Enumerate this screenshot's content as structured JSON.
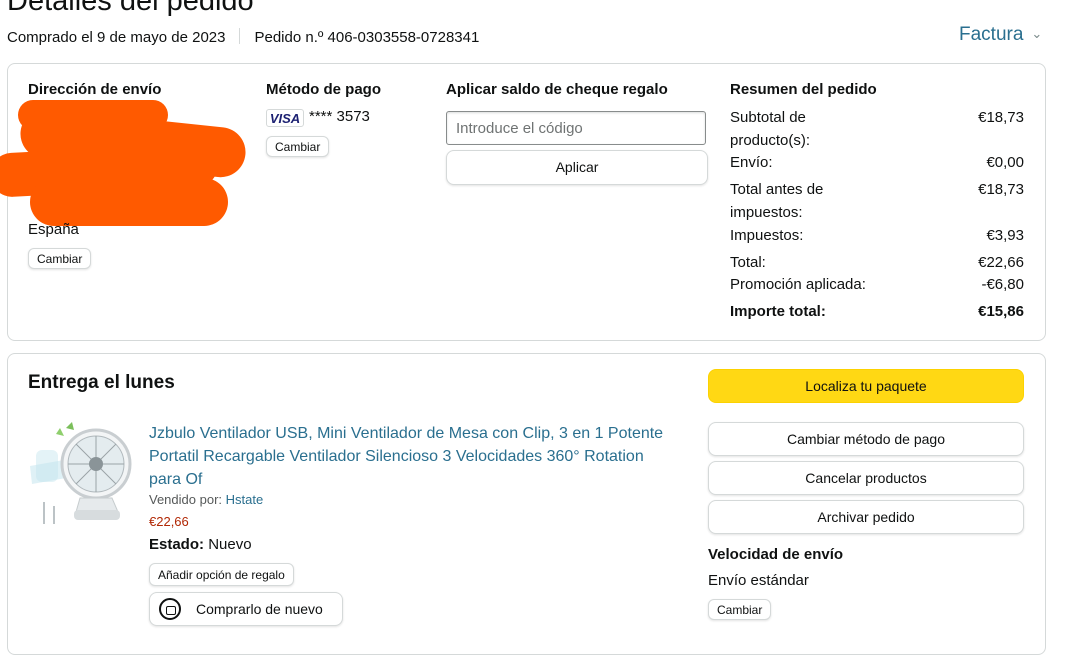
{
  "header": {
    "page_title": "Detalles del pedido",
    "purchased_on": "Comprado el 9 de mayo de 2023",
    "order_number": "Pedido n.º 406-0303558-0728341",
    "invoice_label": "Factura"
  },
  "shipping": {
    "title": "Dirección de envío",
    "country": "España",
    "change_label": "Cambiar"
  },
  "payment": {
    "title": "Método de pago",
    "card_brand": "VISA",
    "card_number": "**** 3573",
    "change_label": "Cambiar"
  },
  "gift_card": {
    "title": "Aplicar saldo de cheque regalo",
    "input_placeholder": "Introduce el código",
    "input_value": "",
    "apply_label": "Aplicar"
  },
  "summary": {
    "title": "Resumen del pedido",
    "rows": [
      {
        "label": "Subtotal de producto(s):",
        "value": "€18,73"
      },
      {
        "label": "Envío:",
        "value": "€0,00"
      },
      {
        "label": "Total antes de impuestos:",
        "value": "€18,73"
      },
      {
        "label": "Impuestos:",
        "value": "€3,93"
      },
      {
        "label": "Total:",
        "value": "€22,66"
      },
      {
        "label": "Promoción aplicada:",
        "value": "-€6,80"
      },
      {
        "label": "Importe total:",
        "value": "€15,86"
      }
    ]
  },
  "delivery": {
    "title": "Entrega el lunes",
    "product_title": "Jzbulo Ventilador USB, Mini Ventilador de Mesa con Clip, 3 en 1 Potente Portatil Recargable Ventilador Silencioso 3 Velocidades 360° Rotation para Of",
    "sold_by_label": "Vendido por:",
    "seller": "Hstate",
    "price": "€22,66",
    "status_label": "Estado:",
    "status_value": "Nuevo",
    "gift_option_label": "Añadir opción de regalo",
    "buy_again_label": "Comprarlo de nuevo"
  },
  "actions": {
    "track": "Localiza tu paquete",
    "change_payment": "Cambiar método de pago",
    "cancel": "Cancelar productos",
    "archive": "Archivar pedido"
  },
  "shipping_speed": {
    "title": "Velocidad de envío",
    "value": "Envío estándar",
    "change_label": "Cambiar"
  },
  "colors": {
    "link": "#2a6f8f",
    "price": "#b12704",
    "primary_button": "#ffd814",
    "redaction": "#ff5a00"
  }
}
